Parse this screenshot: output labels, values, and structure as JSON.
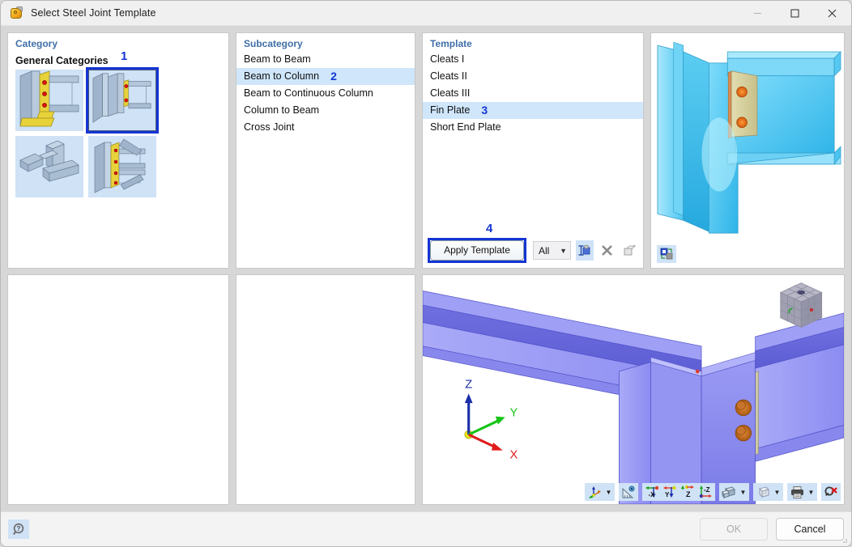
{
  "window": {
    "title": "Select Steel Joint Template",
    "icon": "steel-joint-icon",
    "controls": {
      "minimize": "—",
      "maximize": "□",
      "close": "✕"
    }
  },
  "category": {
    "title": "Category",
    "group_label": "General Categories",
    "annotation": "1",
    "selected_index": 1,
    "items": [
      {
        "name": "moment-end-plate-joint",
        "selected": false
      },
      {
        "name": "beam-to-column-fin-plate-joint",
        "selected": true
      },
      {
        "name": "hollow-section-truss-joint",
        "selected": false
      },
      {
        "name": "braced-beam-column-joint",
        "selected": false
      }
    ]
  },
  "subcategory": {
    "title": "Subcategory",
    "annotation": "2",
    "selected": "Beam to Column",
    "items": [
      "Beam to Beam",
      "Beam to Column",
      "Beam to Continuous Column",
      "Column to Beam",
      "Cross Joint"
    ]
  },
  "template": {
    "title": "Template",
    "annotation": "3",
    "selected": "Fin Plate",
    "items": [
      "Cleats I",
      "Cleats II",
      "Cleats III",
      "Fin Plate",
      "Short End Plate"
    ],
    "toolbar": {
      "apply_label": "Apply Template",
      "apply_annotation": "4",
      "filter_value": "All",
      "filter_options": [
        "All"
      ],
      "buttons": [
        {
          "name": "new-template-icon",
          "enabled": true
        },
        {
          "name": "delete-template-icon",
          "enabled": true
        },
        {
          "name": "edit-template-icon",
          "enabled": false
        }
      ]
    }
  },
  "preview": {
    "name": "joint-preview-3d",
    "corner_button": "export-preview-icon",
    "colors": {
      "steel": "#4ec6f0",
      "plate": "#d8d3a0",
      "bolt": "#e8741a"
    }
  },
  "viewport": {
    "name": "joint-model-3d",
    "axes": {
      "x": "X",
      "y": "Y",
      "z": "Z"
    },
    "axis_colors": {
      "x": "#e01b1b",
      "y": "#16c416",
      "z": "#1b2fa8"
    },
    "model_color": "#8b8bf0",
    "navcube": "view-cube",
    "toolbar": [
      {
        "name": "axis-orientation-icon",
        "caret": true
      },
      {
        "name": "measure-icon",
        "caret": false
      },
      {
        "name": "view-minus-x-icon",
        "label": "-X",
        "caret": false
      },
      {
        "name": "view-y-icon",
        "label": "Y",
        "caret": false
      },
      {
        "name": "view-z-icon",
        "label": "Z",
        "caret": false
      },
      {
        "name": "view-minus-z-icon",
        "label": "-Z",
        "caret": false
      },
      {
        "name": "render-mode-icon",
        "caret": true
      },
      {
        "name": "wireframe-icon",
        "caret": true
      },
      {
        "name": "print-icon",
        "caret": true
      },
      {
        "name": "reset-zoom-icon",
        "caret": false
      }
    ]
  },
  "footer": {
    "help": "help-icon",
    "ok_label": "OK",
    "ok_enabled": false,
    "cancel_label": "Cancel"
  }
}
